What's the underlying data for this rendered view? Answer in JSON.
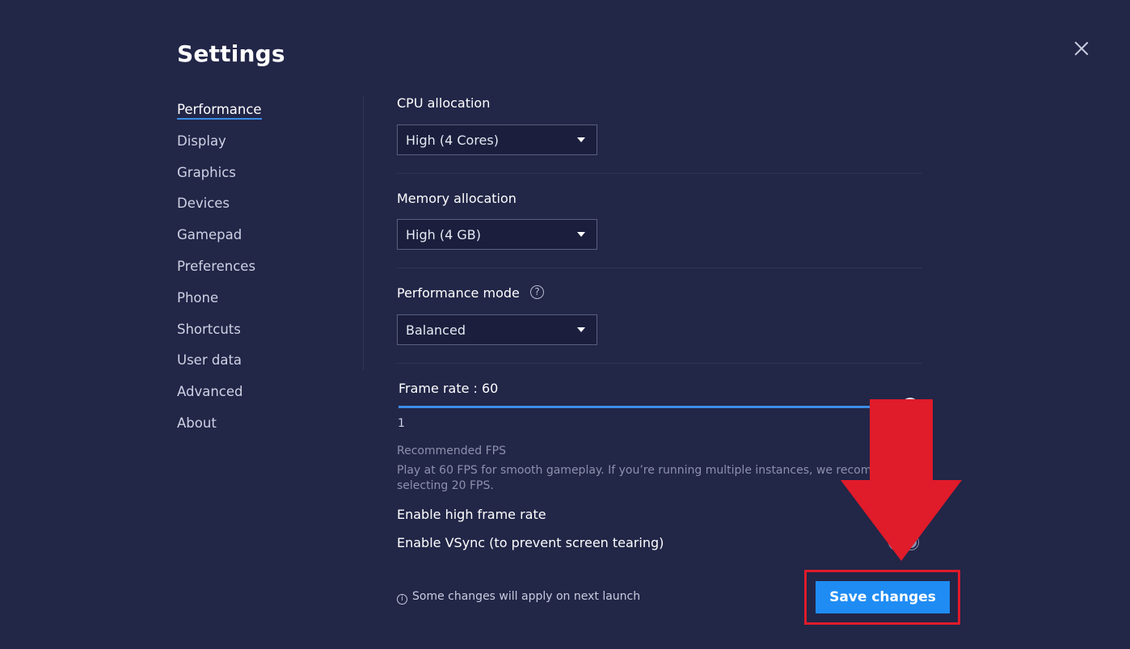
{
  "header": {
    "title": "Settings"
  },
  "sidebar": {
    "items": [
      {
        "label": "Performance",
        "active": true
      },
      {
        "label": "Display"
      },
      {
        "label": "Graphics"
      },
      {
        "label": "Devices"
      },
      {
        "label": "Gamepad"
      },
      {
        "label": "Preferences"
      },
      {
        "label": "Phone"
      },
      {
        "label": "Shortcuts"
      },
      {
        "label": "User data"
      },
      {
        "label": "Advanced"
      },
      {
        "label": "About"
      }
    ]
  },
  "performance": {
    "cpu": {
      "label": "CPU allocation",
      "value": "High (4 Cores)"
    },
    "memory": {
      "label": "Memory allocation",
      "value": "High (4 GB)"
    },
    "mode": {
      "label": "Performance mode",
      "value": "Balanced",
      "help_glyph": "?"
    },
    "frame_rate": {
      "label": "Frame rate : 60",
      "min_label": "1",
      "value_fraction": 1.0
    },
    "recommended": {
      "title": "Recommended FPS",
      "line1": "Play at 60 FPS for smooth gameplay. If you’re running multiple instances, we recomm",
      "line2": "selecting 20 FPS."
    },
    "high_frame_rate": {
      "label": "Enable high frame rate"
    },
    "vsync": {
      "label": "Enable VSync (to prevent screen tearing)"
    }
  },
  "footer": {
    "info_glyph": "i",
    "note": "Some changes will apply on next launch",
    "save_label": "Save changes"
  },
  "colors": {
    "background": "#222647",
    "accent": "#1f8cf3",
    "annotation_red": "#e01b2a"
  }
}
